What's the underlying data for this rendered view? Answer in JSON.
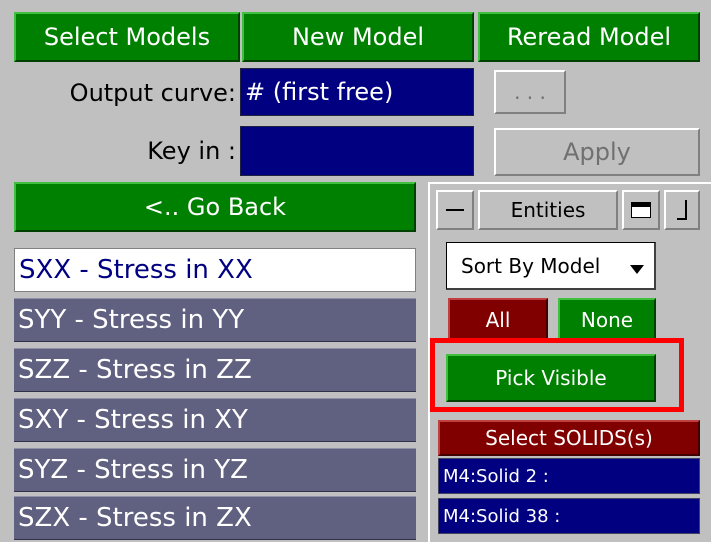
{
  "toolbar": {
    "select_models": "Select Models",
    "new_model": "New Model",
    "reread_model": "Reread Model"
  },
  "output_curve": {
    "label": "Output curve:",
    "value": "# (first free)",
    "browse_label": ". . ."
  },
  "key_in": {
    "label": "Key in :",
    "value": "",
    "apply_label": "Apply"
  },
  "go_back_label": "<.. Go Back",
  "components": [
    "SXX - Stress in XX",
    "SYY - Stress in YY",
    "SZZ - Stress in ZZ",
    "SXY - Stress in XY",
    "SYZ - Stress in YZ",
    "SZX - Stress in ZX"
  ],
  "entities_panel": {
    "title": "Entities",
    "sort_label": "Sort By Model",
    "all_label": "All",
    "none_label": "None",
    "pick_visible_label": "Pick Visible",
    "select_header": "Select SOLIDS(s)",
    "items": [
      "M4:Solid 2 :",
      "M4:Solid 38 :"
    ]
  },
  "colors": {
    "green": "#008000",
    "navy": "#000080",
    "dark_red": "#800000",
    "highlight": "#ff0000",
    "list_gray": "#606080"
  }
}
